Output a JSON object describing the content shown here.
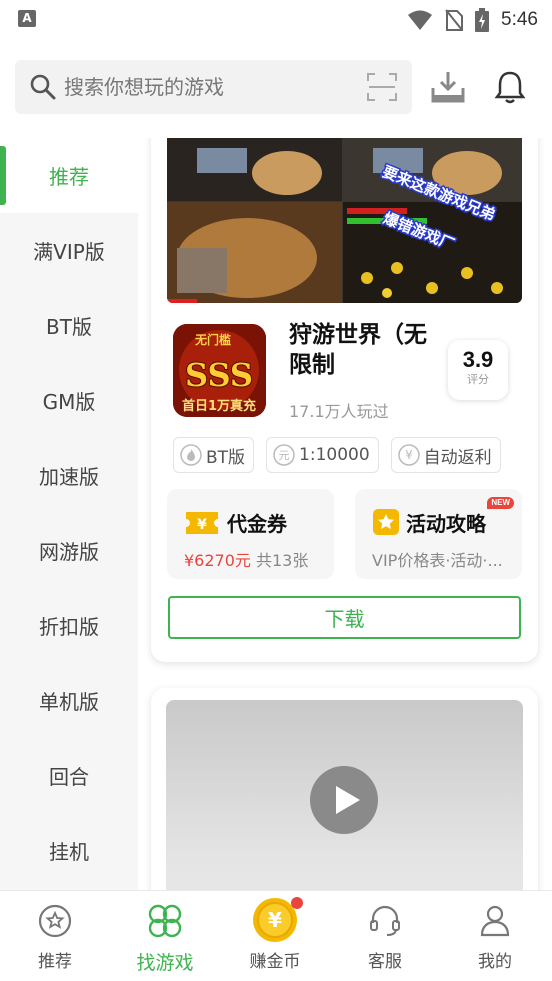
{
  "status_bar": {
    "time": "5:46"
  },
  "search": {
    "placeholder": "搜索你想玩的游戏"
  },
  "sidebar": {
    "items": [
      {
        "label": "推荐",
        "active": true
      },
      {
        "label": "满VIP版"
      },
      {
        "label": "BT版"
      },
      {
        "label": "GM版"
      },
      {
        "label": "加速版"
      },
      {
        "label": "网游版"
      },
      {
        "label": "折扣版"
      },
      {
        "label": "单机版"
      },
      {
        "label": "回合"
      },
      {
        "label": "挂机"
      }
    ]
  },
  "game": {
    "banner_caption_1": "要来这款游戏兄弟",
    "banner_caption_2": "爆错游戏厂",
    "icon_text_top": "无门槛",
    "icon_text_main": "SSS",
    "icon_text_bottom": "首日1万真充",
    "title": "狩游世界（无限制",
    "players": "17.1万人玩过",
    "rating": "3.9",
    "rating_label": "评分",
    "tags": [
      "BT版",
      "1:10000",
      "自动返利"
    ],
    "promos": [
      {
        "title": "代金券",
        "price": "¥6270元",
        "count": " 共13张"
      },
      {
        "title": "活动攻略",
        "subtitle": "VIP价格表·活动·...",
        "badge": "NEW"
      }
    ],
    "download_label": "下载"
  },
  "bottom_nav": {
    "items": [
      {
        "label": "推荐"
      },
      {
        "label": "找游戏",
        "active": true
      },
      {
        "label": "赚金币"
      },
      {
        "label": "客服"
      },
      {
        "label": "我的"
      }
    ]
  },
  "colors": {
    "accent": "#3fb34f",
    "price": "#e8453c",
    "coin": "#f5b800"
  }
}
